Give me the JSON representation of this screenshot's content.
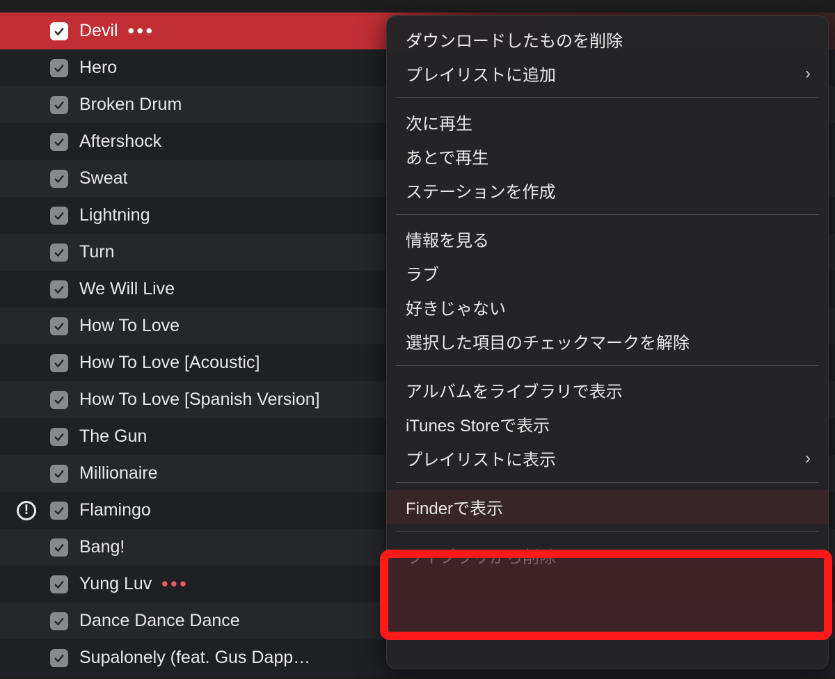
{
  "songs": [
    {
      "title": "Devil",
      "checked": true,
      "selected": true,
      "showEllipsis": true,
      "ellipsisColor": "white",
      "alert": false
    },
    {
      "title": "Hero",
      "checked": true,
      "selected": false,
      "showEllipsis": false,
      "alert": false
    },
    {
      "title": "Broken Drum",
      "checked": true,
      "selected": false,
      "showEllipsis": false,
      "alert": false
    },
    {
      "title": "Aftershock",
      "checked": true,
      "selected": false,
      "showEllipsis": false,
      "alert": false
    },
    {
      "title": "Sweat",
      "checked": true,
      "selected": false,
      "showEllipsis": false,
      "alert": false
    },
    {
      "title": "Lightning",
      "checked": true,
      "selected": false,
      "showEllipsis": false,
      "alert": false
    },
    {
      "title": "Turn",
      "checked": true,
      "selected": false,
      "showEllipsis": false,
      "alert": false
    },
    {
      "title": "We Will Live",
      "checked": true,
      "selected": false,
      "showEllipsis": false,
      "alert": false
    },
    {
      "title": "How To Love",
      "checked": true,
      "selected": false,
      "showEllipsis": false,
      "alert": false
    },
    {
      "title": "How To Love [Acoustic]",
      "checked": true,
      "selected": false,
      "showEllipsis": false,
      "alert": false
    },
    {
      "title": "How To Love [Spanish Version]",
      "checked": true,
      "selected": false,
      "showEllipsis": false,
      "alert": false
    },
    {
      "title": "The Gun",
      "checked": true,
      "selected": false,
      "showEllipsis": false,
      "alert": false
    },
    {
      "title": "Millionaire",
      "checked": true,
      "selected": false,
      "showEllipsis": false,
      "alert": false
    },
    {
      "title": "Flamingo",
      "checked": true,
      "selected": false,
      "showEllipsis": false,
      "alert": true
    },
    {
      "title": "Bang!",
      "checked": true,
      "selected": false,
      "showEllipsis": false,
      "alert": false
    },
    {
      "title": "Yung Luv",
      "checked": true,
      "selected": false,
      "showEllipsis": true,
      "ellipsisColor": "red",
      "alert": false
    },
    {
      "title": "Dance Dance Dance",
      "checked": true,
      "selected": false,
      "showEllipsis": false,
      "alert": false
    },
    {
      "title": "Supalonely (feat. Gus Dapp…",
      "checked": true,
      "selected": false,
      "showEllipsis": false,
      "alert": false
    }
  ],
  "contextMenu": {
    "groups": [
      [
        {
          "label": "ダウンロードしたものを削除",
          "submenu": false
        },
        {
          "label": "プレイリストに追加",
          "submenu": true
        }
      ],
      [
        {
          "label": "次に再生",
          "submenu": false
        },
        {
          "label": "あとで再生",
          "submenu": false
        },
        {
          "label": "ステーションを作成",
          "submenu": false
        }
      ],
      [
        {
          "label": "情報を見る",
          "submenu": false
        },
        {
          "label": "ラブ",
          "submenu": false
        },
        {
          "label": "好きじゃない",
          "submenu": false
        },
        {
          "label": "選択した項目のチェックマークを解除",
          "submenu": false
        }
      ],
      [
        {
          "label": "アルバムをライブラリで表示",
          "submenu": false
        },
        {
          "label": "iTunes Storeで表示",
          "submenu": false
        },
        {
          "label": "プレイリストに表示",
          "submenu": true
        }
      ],
      [
        {
          "label": "Finderで表示",
          "submenu": false,
          "highlighted": true
        }
      ],
      [
        {
          "label": "ライブラリから削除",
          "submenu": false,
          "dim": true
        }
      ]
    ]
  },
  "icons": {
    "ellipsis": "•••",
    "chevron": "›",
    "alert": "!"
  }
}
